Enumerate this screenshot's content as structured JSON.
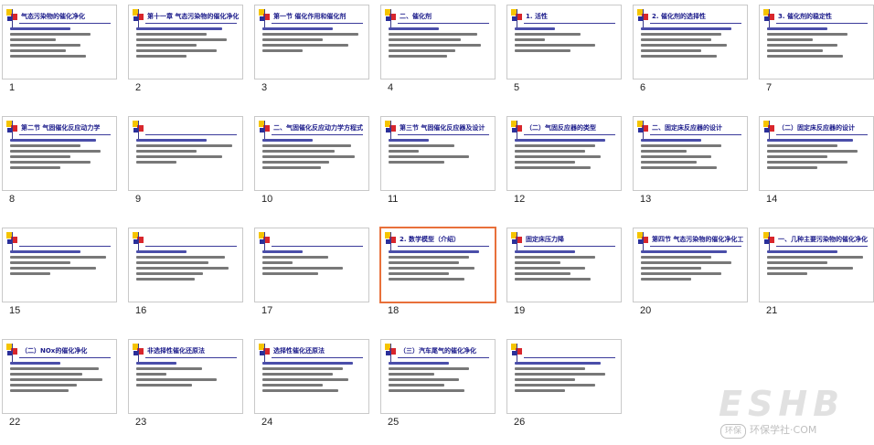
{
  "slides": [
    {
      "number": "1",
      "title": "气态污染物的催化净化"
    },
    {
      "number": "2",
      "title": "第十一章 气态污染物的催化净化"
    },
    {
      "number": "3",
      "title": "第一节 催化作用和催化剂"
    },
    {
      "number": "4",
      "title": "二、催化剂"
    },
    {
      "number": "5",
      "title": "1. 活性"
    },
    {
      "number": "6",
      "title": "2. 催化剂的选择性"
    },
    {
      "number": "7",
      "title": "3. 催化剂的稳定性"
    },
    {
      "number": "8",
      "title": "第二节 气固催化反应动力学"
    },
    {
      "number": "9",
      "title": ""
    },
    {
      "number": "10",
      "title": "二、气固催化反应动力学方程式"
    },
    {
      "number": "11",
      "title": "第三节 气固催化反应器及设计"
    },
    {
      "number": "12",
      "title": "（二）气固反应器的类型"
    },
    {
      "number": "13",
      "title": "二、固定床反应器的设计"
    },
    {
      "number": "14",
      "title": "（二）固定床反应器的设计"
    },
    {
      "number": "15",
      "title": ""
    },
    {
      "number": "16",
      "title": ""
    },
    {
      "number": "17",
      "title": ""
    },
    {
      "number": "18",
      "title": "2. 数学模型（介绍）"
    },
    {
      "number": "19",
      "title": "固定床压力降"
    },
    {
      "number": "20",
      "title": "第四节 气态污染物的催化净化工艺"
    },
    {
      "number": "21",
      "title": "一、几种主要污染物的催化净化"
    },
    {
      "number": "22",
      "title": "（二）NOx的催化净化"
    },
    {
      "number": "23",
      "title": "非选择性催化还原法"
    },
    {
      "number": "24",
      "title": "选择性催化还原法"
    },
    {
      "number": "25",
      "title": "（三）汽车尾气的催化净化"
    },
    {
      "number": "26",
      "title": ""
    }
  ],
  "selected_slide": "18",
  "watermark": {
    "big": "ESHB",
    "small_prefix": "环保",
    "small": "环保学社·COM"
  }
}
